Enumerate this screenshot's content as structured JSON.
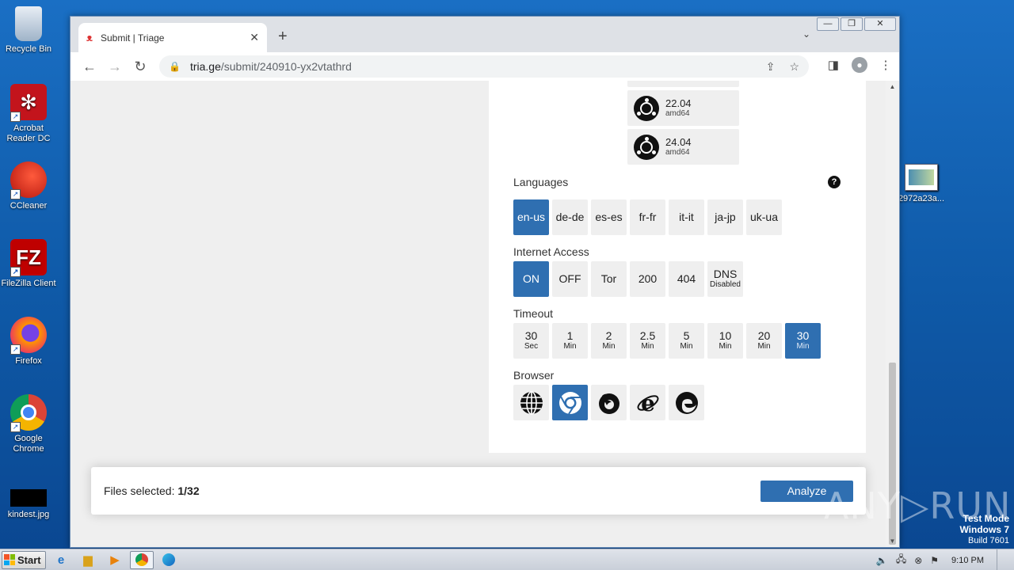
{
  "desktop": {
    "icons": [
      {
        "label": "Recycle Bin"
      },
      {
        "label": "Acrobat Reader DC"
      },
      {
        "label": "CCleaner"
      },
      {
        "label": "FileZilla Client"
      },
      {
        "label": "Firefox"
      },
      {
        "label": "Google Chrome"
      },
      {
        "label": "kindest.jpg"
      }
    ],
    "right_icon": {
      "label": "2972a23a..."
    }
  },
  "browser": {
    "tab": {
      "title": "Submit | Triage",
      "close": "✕"
    },
    "new_tab": "+",
    "tab_dropdown": "⌄",
    "window_controls": {
      "minimize": "—",
      "restore": "❐",
      "close": "✕"
    },
    "url": {
      "host": "tria.ge",
      "path": "/submit/240910-yx2vtathrd"
    }
  },
  "submit": {
    "os_options": [
      {
        "version": "22.04",
        "arch": "amd64"
      },
      {
        "version": "24.04",
        "arch": "amd64"
      }
    ],
    "languages": {
      "title": "Languages",
      "help": "?",
      "options": [
        {
          "label": "en-us",
          "selected": true
        },
        {
          "label": "de-de",
          "selected": false
        },
        {
          "label": "es-es",
          "selected": false
        },
        {
          "label": "fr-fr",
          "selected": false
        },
        {
          "label": "it-it",
          "selected": false
        },
        {
          "label": "ja-jp",
          "selected": false
        },
        {
          "label": "uk-ua",
          "selected": false
        }
      ]
    },
    "internet": {
      "title": "Internet Access",
      "options": [
        {
          "label": "ON",
          "sub": "",
          "selected": true
        },
        {
          "label": "OFF",
          "sub": "",
          "selected": false
        },
        {
          "label": "Tor",
          "sub": "",
          "selected": false
        },
        {
          "label": "200",
          "sub": "",
          "selected": false
        },
        {
          "label": "404",
          "sub": "",
          "selected": false
        },
        {
          "label": "DNS",
          "sub": "Disabled",
          "selected": false
        }
      ]
    },
    "timeout": {
      "title": "Timeout",
      "options": [
        {
          "label": "30",
          "sub": "Sec",
          "selected": false
        },
        {
          "label": "1",
          "sub": "Min",
          "selected": false
        },
        {
          "label": "2",
          "sub": "Min",
          "selected": false
        },
        {
          "label": "2.5",
          "sub": "Min",
          "selected": false
        },
        {
          "label": "5",
          "sub": "Min",
          "selected": false
        },
        {
          "label": "10",
          "sub": "Min",
          "selected": false
        },
        {
          "label": "20",
          "sub": "Min",
          "selected": false
        },
        {
          "label": "30",
          "sub": "Min",
          "selected": true
        }
      ]
    },
    "browser": {
      "title": "Browser",
      "options": [
        {
          "icon": "globe-icon",
          "selected": false
        },
        {
          "icon": "chrome-icon",
          "selected": true
        },
        {
          "icon": "firefox-icon",
          "selected": false
        },
        {
          "icon": "internet-explorer-icon",
          "selected": false
        },
        {
          "icon": "edge-icon",
          "selected": false
        }
      ]
    },
    "footer": {
      "files_label": "Files selected: ",
      "files_count": "1/32",
      "analyze": "Analyze"
    }
  },
  "watermark": "ANY▷RUN",
  "test_mode": {
    "line1": "Test Mode",
    "line2": "Windows 7",
    "line3": "Build 7601"
  },
  "taskbar": {
    "start": "Start",
    "clock": "9:10 PM"
  }
}
